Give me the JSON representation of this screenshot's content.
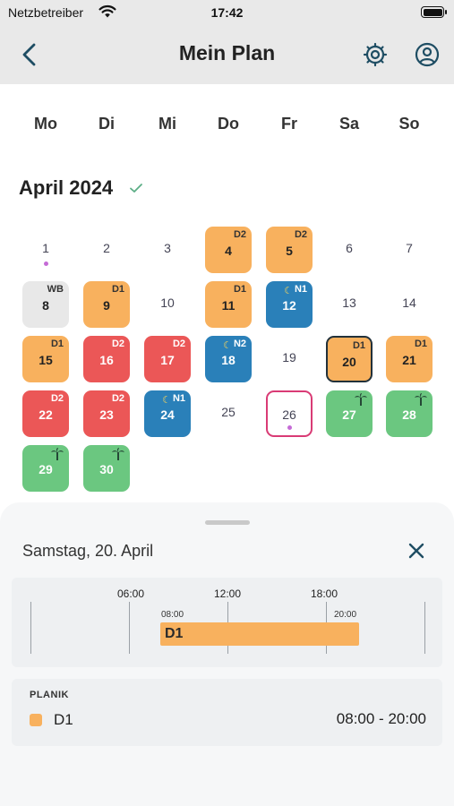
{
  "status": {
    "carrier": "Netzbetreiber",
    "time": "17:42"
  },
  "nav": {
    "title": "Mein Plan",
    "back_icon": "chevron-left-icon",
    "settings_icon": "gear-icon",
    "profile_icon": "user-circle-icon"
  },
  "weekdays": [
    "Mo",
    "Di",
    "Mi",
    "Do",
    "Fr",
    "Sa",
    "So"
  ],
  "month": {
    "title": "April 2024",
    "status_icon": "check-icon"
  },
  "colors": {
    "orange": "#f8b15e",
    "red": "#eb5757",
    "blue": "#2a80b9",
    "green": "#6bc780",
    "grey": "#e8e8e8",
    "accent_today": "#d93b75",
    "dot": "#c56bd6"
  },
  "days": [
    {
      "n": "1",
      "dot": true
    },
    {
      "n": "2"
    },
    {
      "n": "3"
    },
    {
      "n": "4",
      "code": "D2",
      "color": "orange"
    },
    {
      "n": "5",
      "code": "D2",
      "color": "orange"
    },
    {
      "n": "6"
    },
    {
      "n": "7"
    },
    {
      "n": "8",
      "code": "WB",
      "color": "grey"
    },
    {
      "n": "9",
      "code": "D1",
      "color": "orange"
    },
    {
      "n": "10"
    },
    {
      "n": "11",
      "code": "D1",
      "color": "orange"
    },
    {
      "n": "12",
      "code": "N1",
      "color": "blue",
      "moon": true
    },
    {
      "n": "13"
    },
    {
      "n": "14"
    },
    {
      "n": "15",
      "code": "D1",
      "color": "orange"
    },
    {
      "n": "16",
      "code": "D2",
      "color": "red"
    },
    {
      "n": "17",
      "code": "D2",
      "color": "red"
    },
    {
      "n": "18",
      "code": "N2",
      "color": "blue",
      "moon": true
    },
    {
      "n": "19"
    },
    {
      "n": "20",
      "code": "D1",
      "color": "orange",
      "selected": true
    },
    {
      "n": "21",
      "code": "D1",
      "color": "orange"
    },
    {
      "n": "22",
      "code": "D2",
      "color": "red"
    },
    {
      "n": "23",
      "code": "D2",
      "color": "red"
    },
    {
      "n": "24",
      "code": "N1",
      "color": "blue",
      "moon": true
    },
    {
      "n": "25"
    },
    {
      "n": "26",
      "today": true,
      "dot": true
    },
    {
      "n": "27",
      "color": "green",
      "palm": true
    },
    {
      "n": "28",
      "color": "green",
      "palm": true
    },
    {
      "n": "29",
      "color": "green",
      "palm": true
    },
    {
      "n": "30",
      "color": "green",
      "palm": true
    }
  ],
  "sheet": {
    "date": "Samstag, 20. April",
    "close_icon": "close-icon",
    "timeline": {
      "ticks": [
        "06:00",
        "12:00",
        "18:00"
      ],
      "start_label": "08:00",
      "end_label": "20:00",
      "bar_label": "D1"
    },
    "list": {
      "heading": "PLANIK",
      "item_label": "D1",
      "item_time": "08:00 - 20:00"
    }
  }
}
